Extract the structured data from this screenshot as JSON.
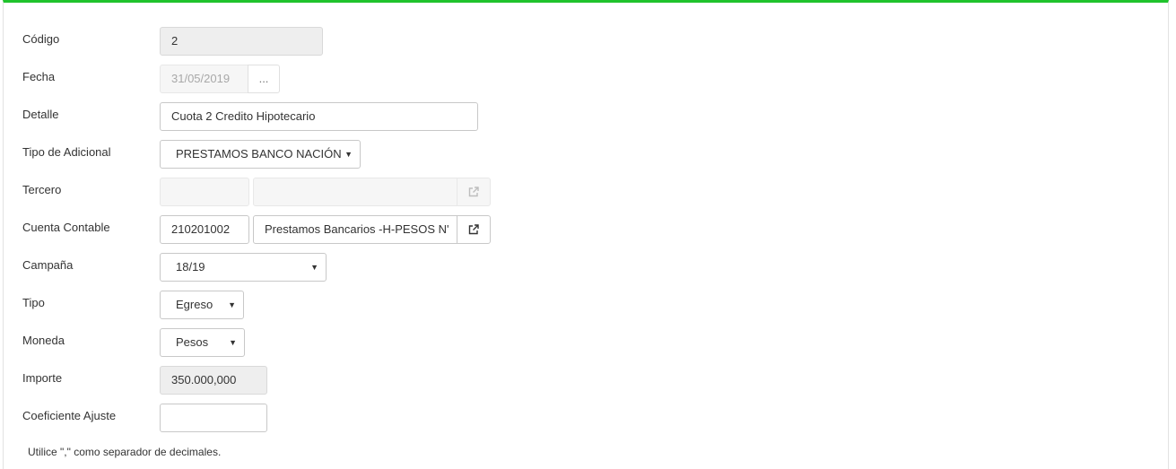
{
  "form": {
    "codigo": {
      "label": "Código",
      "value": "2"
    },
    "fecha": {
      "label": "Fecha",
      "value": "31/05/2019",
      "picker_label": "..."
    },
    "detalle": {
      "label": "Detalle",
      "value": "Cuota 2 Credito Hipotecario"
    },
    "tipo_adicional": {
      "label": "Tipo de Adicional",
      "selected": "PRESTAMOS BANCO NACIÓN"
    },
    "tercero": {
      "label": "Tercero",
      "code": "",
      "name": ""
    },
    "cuenta_contable": {
      "label": "Cuenta Contable",
      "code": "210201002",
      "name": "Prestamos Bancarios -H-PESOS N'"
    },
    "campana": {
      "label": "Campaña",
      "selected": "18/19"
    },
    "tipo": {
      "label": "Tipo",
      "selected": "Egreso"
    },
    "moneda": {
      "label": "Moneda",
      "selected": "Pesos"
    },
    "importe": {
      "label": "Importe",
      "value": "350.000,000"
    },
    "coeficiente": {
      "label": "Coeficiente Ajuste",
      "value": ""
    },
    "hint": "Utilice \",\" como separador de decimales."
  },
  "icons": {
    "caret": "caret-down-icon",
    "external": "external-link-icon"
  },
  "colors": {
    "accent_top_border": "#1fc32c",
    "readonly_bg": "#eeeeee"
  }
}
